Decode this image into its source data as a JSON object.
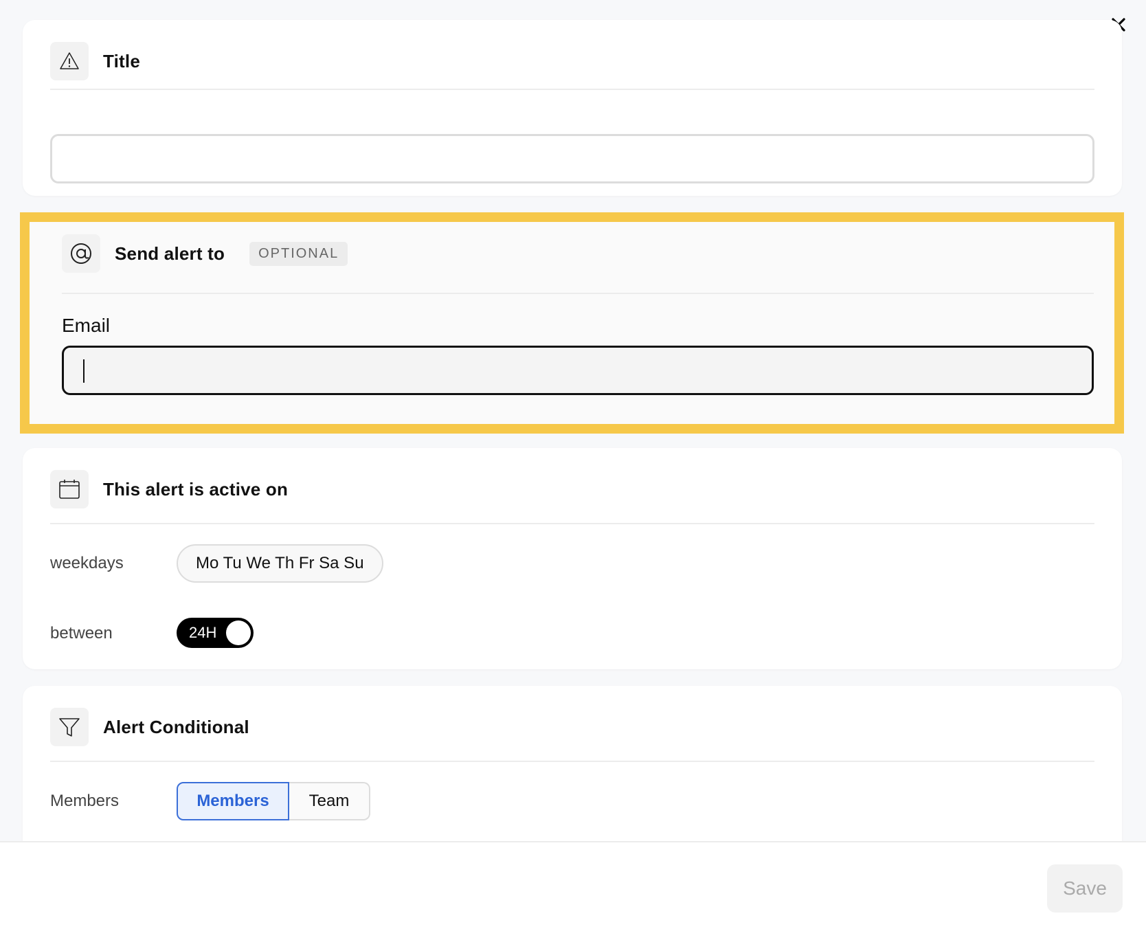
{
  "close": {
    "label": "✕"
  },
  "title_section": {
    "heading": "Title",
    "input_value": "",
    "icon": "warning-icon"
  },
  "send_section": {
    "heading": "Send alert to",
    "badge": "OPTIONAL",
    "icon": "at-icon",
    "email_label": "Email",
    "email_value": "",
    "highlight_color": "#f6c84a"
  },
  "active_section": {
    "heading": "This alert is active on",
    "icon": "calendar-icon",
    "weekdays_label": "weekdays",
    "weekdays_value": "Mo Tu We Th Fr Sa Su",
    "between_label": "between",
    "toggle_label": "24H",
    "toggle_on": true
  },
  "conditional_section": {
    "heading": "Alert Conditional",
    "icon": "filter-icon",
    "members_label": "Members",
    "segments": [
      {
        "label": "Members",
        "active": true
      },
      {
        "label": "Team",
        "active": false
      }
    ],
    "accent_color": "#2b63d6"
  },
  "footer": {
    "save_label": "Save",
    "save_enabled": false
  }
}
